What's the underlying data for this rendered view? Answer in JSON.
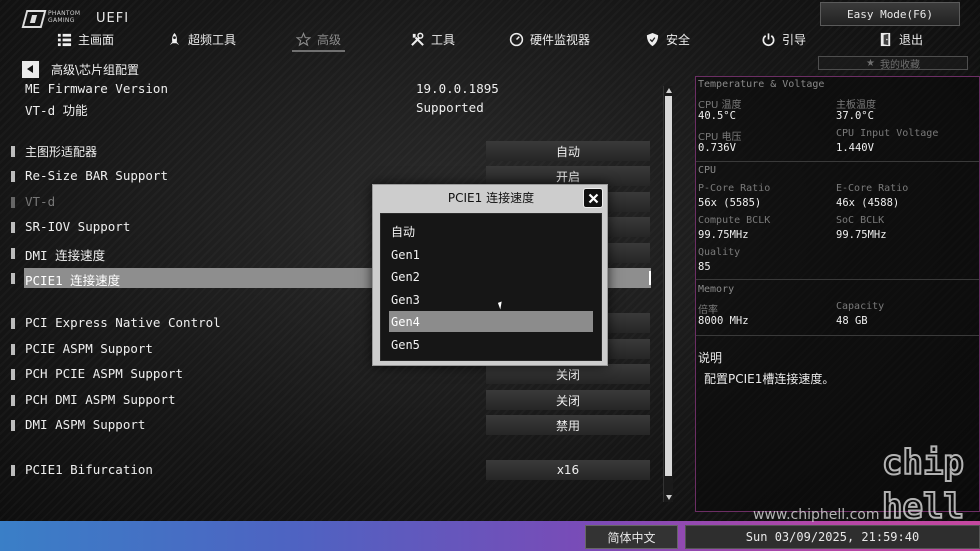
{
  "brand": {
    "line1": "PHANTOM",
    "line2": "GAMING",
    "product": "UEFI"
  },
  "top": {
    "easy_mode": "Easy Mode(F6)"
  },
  "nav": {
    "items": [
      {
        "label": "主画面",
        "icon": "list-icon"
      },
      {
        "label": "超频工具",
        "icon": "rocket-icon"
      },
      {
        "label": "高级",
        "icon": "star-icon",
        "active": true
      },
      {
        "label": "工具",
        "icon": "tools-icon"
      },
      {
        "label": "硬件监视器",
        "icon": "monitor-gauge-icon"
      },
      {
        "label": "安全",
        "icon": "shield-icon"
      },
      {
        "label": "引导",
        "icon": "power-icon"
      },
      {
        "label": "退出",
        "icon": "exit-icon"
      }
    ],
    "favorites": "我的收藏"
  },
  "breadcrumb": "高级\\芯片组配置",
  "info": [
    {
      "label": "ME Firmware Version",
      "value": "19.0.0.1895"
    },
    {
      "label": "VT-d 功能",
      "value": "Supported"
    }
  ],
  "options": [
    {
      "label": "主图形适配器",
      "value": "自动"
    },
    {
      "label": "Re-Size BAR Support",
      "value": "开启"
    },
    {
      "label": "VT-d",
      "value": ""
    },
    {
      "label": "SR-IOV Support",
      "value": ""
    },
    {
      "label": "DMI 连接速度",
      "value": ""
    },
    {
      "label": "PCIE1 连接速度",
      "value": ""
    },
    {
      "label": "PCI Express Native Control",
      "value": ""
    },
    {
      "label": "PCIE ASPM Support",
      "value": ""
    },
    {
      "label": "PCH PCIE ASPM Support",
      "value": "关闭"
    },
    {
      "label": "PCH DMI ASPM Support",
      "value": "关闭"
    },
    {
      "label": "DMI ASPM Support",
      "value": "禁用"
    },
    {
      "label": "PCIE1 Bifurcation",
      "value": "x16"
    }
  ],
  "popup": {
    "title": "PCIE1 连接速度",
    "options": [
      "自动",
      "Gen1",
      "Gen2",
      "Gen3",
      "Gen4",
      "Gen5"
    ],
    "highlighted": "Gen4"
  },
  "panel": {
    "section_tv": "Temperature & Voltage",
    "cpu_temp_label": "CPU 温度",
    "cpu_temp": "40.5°C",
    "mb_temp_label": "主板温度",
    "mb_temp": "37.0°C",
    "cpu_volt_label": "CPU 电压",
    "cpu_volt": "0.736V",
    "cpu_input_label": "CPU Input Voltage",
    "cpu_input": "1.440V",
    "section_cpu": "CPU",
    "pcore_label": "P-Core Ratio",
    "pcore": "56x (5585)",
    "ecore_label": "E-Core Ratio",
    "ecore": "46x (4588)",
    "bclk_label": "Compute BCLK",
    "bclk": "99.75MHz",
    "socbclk_label": "SoC BCLK",
    "socbclk": "99.75MHz",
    "quality_label": "Quality",
    "quality": "85",
    "section_mem": "Memory",
    "freq_label": "倍率",
    "freq": "8000 MHz",
    "cap_label": "Capacity",
    "cap": "48 GB",
    "help_title": "说明",
    "help_text": "配置PCIE1槽连接速度。"
  },
  "bottom": {
    "language": "简体中文",
    "datetime": "Sun 03/09/2025, 21:59:40"
  },
  "watermark": {
    "url": "www.chiphell.com",
    "logo_top": "chip",
    "logo_bottom": "hell"
  },
  "colors": {
    "panel_border": "#6c2e64",
    "bottom_gradient_start": "#3a7fc7",
    "bottom_gradient_end": "#c4489f",
    "selection": "#8e8e8e"
  }
}
